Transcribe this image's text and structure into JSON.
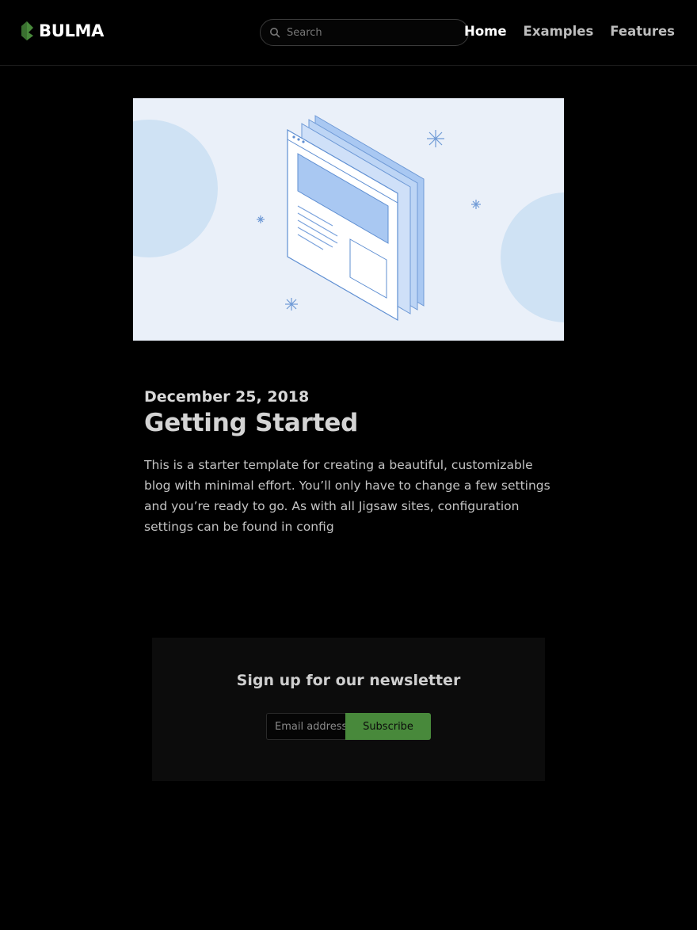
{
  "brand": {
    "name": "BULMA",
    "logo_icon": "bulma-leaf-icon",
    "logo_color": "#48893b"
  },
  "search": {
    "placeholder": "Search",
    "icon": "search-icon"
  },
  "nav": {
    "items": [
      {
        "label": "Home",
        "active": true
      },
      {
        "label": "Examples"
      },
      {
        "label": "Features"
      }
    ]
  },
  "hero": {
    "illustration": "browser-windows-illustration",
    "background": "#eaf0f9"
  },
  "post": {
    "date": "December 25, 2018",
    "title": "Getting Started",
    "excerpt": "This is a starter template for creating a beautiful, customizable blog with minimal effort. You’ll only have to change a few settings and you’re ready to go. As with all Jigsaw sites, configuration settings can be found in config"
  },
  "newsletter": {
    "title": "Sign up for our newsletter",
    "email_placeholder": "Email address",
    "button_label": "Subscribe",
    "button_color": "#48893b"
  }
}
